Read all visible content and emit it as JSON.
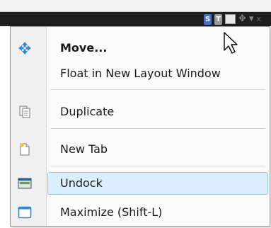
{
  "panel_header": {
    "s_badge": "S",
    "t_badge": "T",
    "move_glyph": "✥",
    "dropdown_glyph": "▾",
    "close_glyph": "x"
  },
  "menu": {
    "items": [
      {
        "label": "Move...",
        "icon": "move-arrows-icon",
        "bold": true
      },
      {
        "label": "Float in New Layout Window",
        "icon": null
      },
      {
        "label": "Duplicate",
        "icon": "duplicate-pages-icon"
      },
      {
        "label": "New Tab",
        "icon": "new-page-icon"
      },
      {
        "label": "Undock",
        "icon": "undock-window-icon",
        "highlighted": true
      },
      {
        "label": "Maximize (Shift-L)",
        "icon": "maximize-window-icon"
      }
    ]
  },
  "colors": {
    "highlight_fill": "#dbeefb",
    "highlight_border": "#8fc3e8",
    "move_icon_blue": "#2a8ad8",
    "header_dark": "#1e1e1e"
  }
}
